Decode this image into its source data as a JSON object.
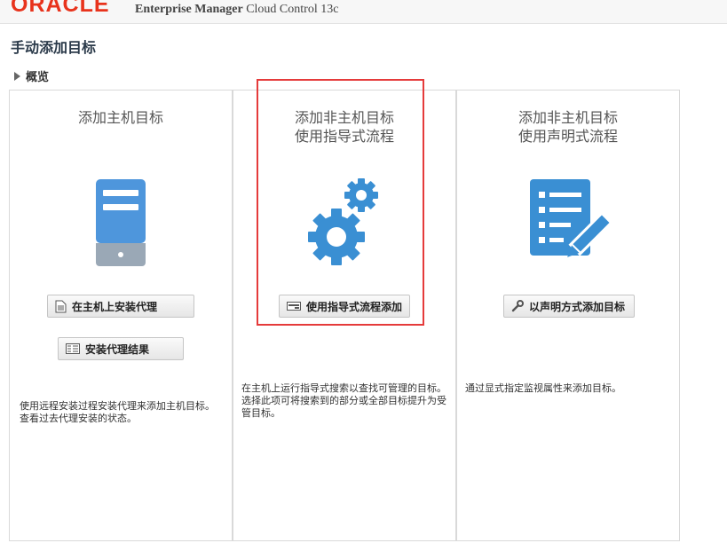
{
  "header": {
    "logo": "ORACLE",
    "product_name": "Enterprise Manager",
    "product_suffix": "Cloud Control 13c"
  },
  "page": {
    "title": "手动添加目标",
    "overview_label": "概览"
  },
  "panels": [
    {
      "title_line1": "添加主机目标",
      "title_line2": "",
      "buttons": [
        "在主机上安装代理",
        "安装代理结果"
      ],
      "description": "使用远程安装过程安装代理来添加主机目标。查看过去代理安装的状态。"
    },
    {
      "title_line1": "添加非主机目标",
      "title_line2": "使用指导式流程",
      "buttons": [
        "使用指导式流程添加"
      ],
      "description": "在主机上运行指导式搜索以查找可管理的目标。选择此项可将搜索到的部分或全部目标提升为受管目标。"
    },
    {
      "title_line1": "添加非主机目标",
      "title_line2": "使用声明式流程",
      "buttons": [
        "以声明方式添加目标"
      ],
      "description": "通过显式指定监视属性来添加目标。"
    }
  ],
  "icons": {
    "panel1": "server-icon",
    "panel2": "gears-icon",
    "panel3": "form-edit-icon"
  },
  "colors": {
    "accent_blue": "#3a8fd3",
    "highlight_red": "#e53b3b",
    "oracle_red": "#e8331c"
  }
}
